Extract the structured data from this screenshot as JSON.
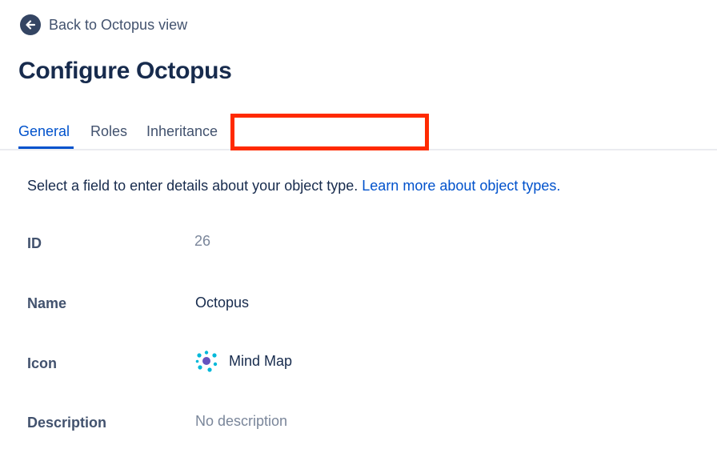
{
  "back_link": {
    "label": "Back to Octopus view",
    "icon": "arrow-left-icon"
  },
  "page_title": "Configure Octopus",
  "tabs": [
    {
      "label": "General",
      "active": true
    },
    {
      "label": "Roles",
      "active": false
    },
    {
      "label": "Inheritance",
      "active": false
    },
    {
      "label": "",
      "active": false
    }
  ],
  "intro": {
    "text": "Select a field to enter details about your object type.",
    "link": "Learn more about object types."
  },
  "fields": {
    "id": {
      "label": "ID",
      "value": "26"
    },
    "name": {
      "label": "Name",
      "value": "Octopus"
    },
    "icon": {
      "label": "Icon",
      "value": "Mind Map",
      "icon": "mind-map-icon"
    },
    "description": {
      "label": "Description",
      "value": "No description"
    }
  },
  "colors": {
    "accent": "#0052cc",
    "text": "#172b4d",
    "muted": "#7a869a",
    "redaction": "#ff2a00"
  }
}
